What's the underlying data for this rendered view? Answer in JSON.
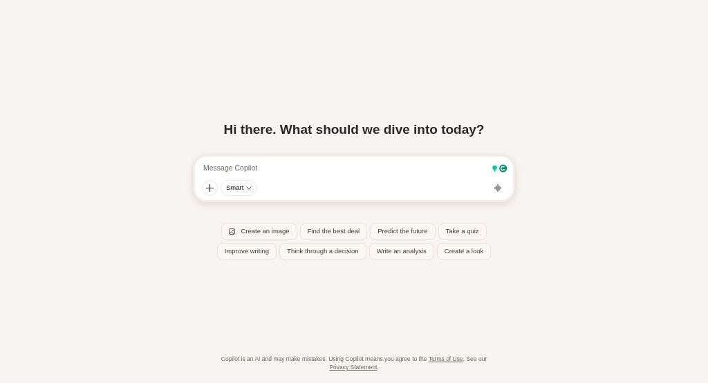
{
  "heading": "Hi there. What should we dive into today?",
  "composer": {
    "placeholder": "Message Copilot",
    "mode": "Smart"
  },
  "suggestions": [
    [
      {
        "label": "Create an image",
        "kind": "image"
      },
      {
        "label": "Find the best deal",
        "kind": "plain"
      },
      {
        "label": "Predict the future",
        "kind": "plain"
      },
      {
        "label": "Take a quiz",
        "kind": "plain"
      }
    ],
    [
      {
        "label": "Improve writing",
        "kind": "plain"
      },
      {
        "label": "Think through a decision",
        "kind": "plain"
      },
      {
        "label": "Write an analysis",
        "kind": "plain"
      },
      {
        "label": "Create a look",
        "kind": "plain"
      }
    ]
  ],
  "footer": [
    {
      "kind": "text",
      "text": "Copilot is an AI and may make mistakes. Using Copilot means you agree to the "
    },
    {
      "kind": "link",
      "text": "Terms of Use"
    },
    {
      "kind": "text",
      "text": ". See our "
    },
    {
      "kind": "link",
      "text": "Privacy Statement"
    },
    {
      "kind": "text",
      "text": "."
    }
  ]
}
